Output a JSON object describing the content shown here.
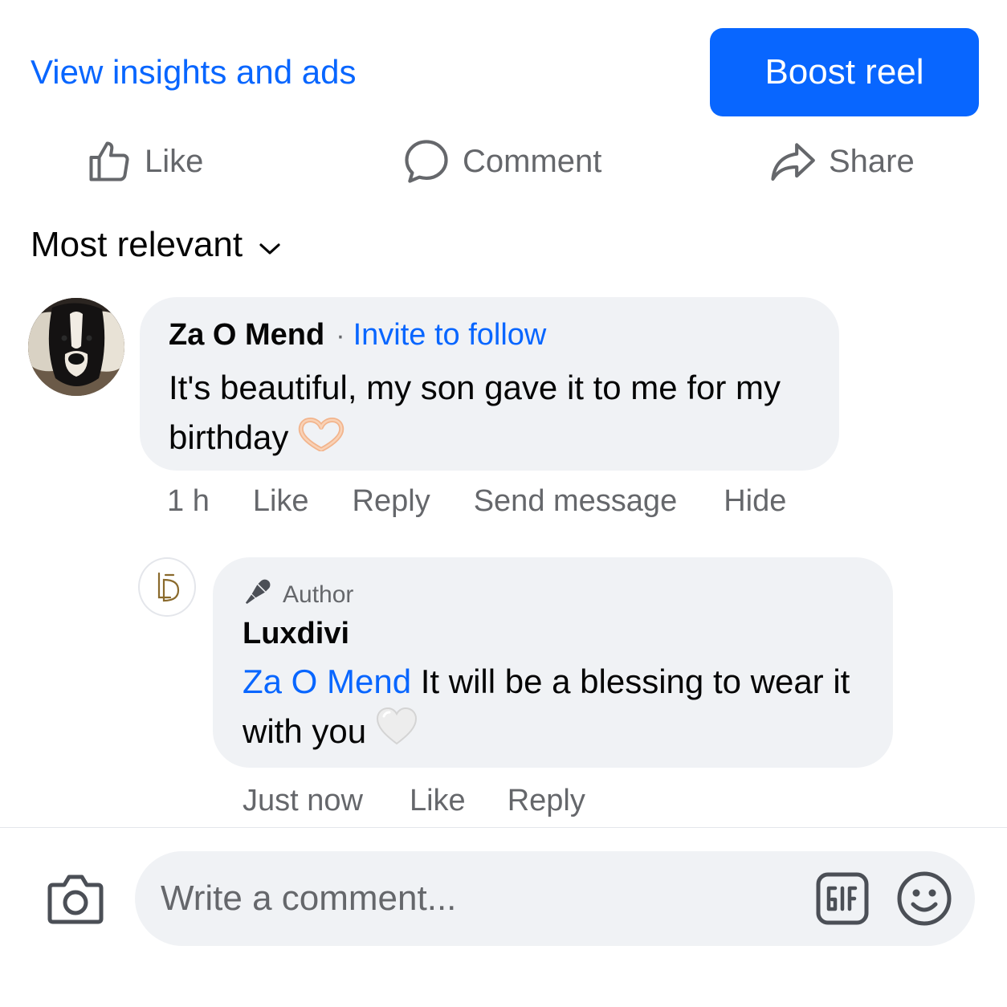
{
  "header": {
    "insights_link": "View insights and ads",
    "boost_button": "Boost reel"
  },
  "actions": {
    "like": "Like",
    "comment": "Comment",
    "share": "Share"
  },
  "sort": {
    "label": "Most relevant"
  },
  "comment": {
    "author": "Za O Mend",
    "separator": "·",
    "invite": "Invite to follow",
    "text": "It's beautiful, my son gave it to me for my birthday",
    "emoji": "heart-hands-emoji",
    "meta": {
      "time": "1 h",
      "like": "Like",
      "reply": "Reply",
      "send_message": "Send message",
      "hide": "Hide"
    }
  },
  "reply": {
    "badge": "Author",
    "author": "Luxdivi",
    "mention": "Za O Mend",
    "text": " It will be a blessing to wear it with you",
    "emoji": "white-heart-emoji",
    "meta": {
      "time": "Just now",
      "like": "Like",
      "reply": "Reply"
    }
  },
  "composer": {
    "placeholder": "Write a comment..."
  },
  "colors": {
    "accent": "#0866ff",
    "bubble": "#f0f2f5",
    "secondary_text": "#65676b"
  }
}
